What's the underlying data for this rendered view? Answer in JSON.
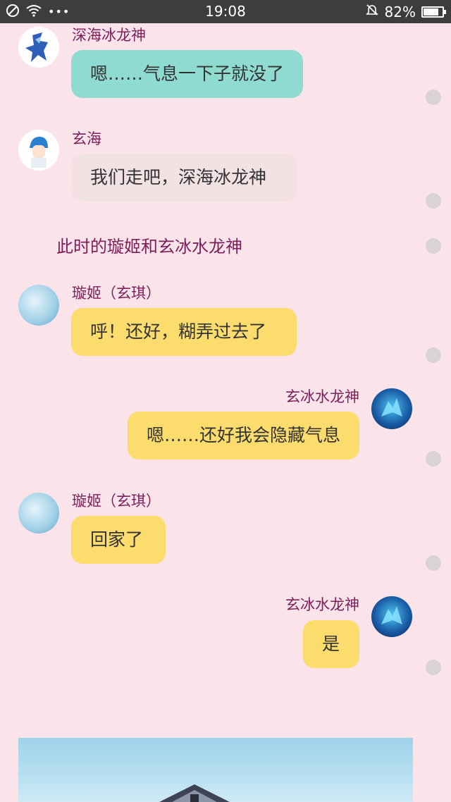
{
  "status_bar": {
    "time": "19:08",
    "battery_percent": "82%",
    "battery_level": 0.82,
    "icons": [
      "no-sim-icon",
      "wifi-icon",
      "more-dots-icon",
      "mute-bell-icon",
      "battery-icon"
    ]
  },
  "chat": {
    "messages": [
      {
        "sender": "深海冰龙神",
        "text": "嗯……气息一下子就没了",
        "side": "left",
        "bubble_color": "#8fdbd1"
      },
      {
        "sender": "玄海",
        "text": "我们走吧，深海冰龙神",
        "side": "left",
        "bubble_color": "#f3e2e4"
      },
      {
        "sender": "璇姬（玄琪）",
        "text": "呼！还好，糊弄过去了",
        "side": "left",
        "bubble_color": "#fddc6e"
      },
      {
        "sender": "玄冰水龙神",
        "text": "嗯……还好我会隐藏气息",
        "side": "right",
        "bubble_color": "#fddc6e"
      },
      {
        "sender": "璇姬（玄琪）",
        "text": "回家了",
        "side": "left",
        "bubble_color": "#fddc6e"
      },
      {
        "sender": "玄冰水龙神",
        "text": "是",
        "side": "right",
        "bubble_color": "#fddc6e"
      }
    ],
    "narration": "此时的璇姬和玄冰水龙神"
  },
  "colors": {
    "background": "#fbe3ea",
    "name_text": "#7b1f5a",
    "status_bar": "#3d3d3d"
  }
}
